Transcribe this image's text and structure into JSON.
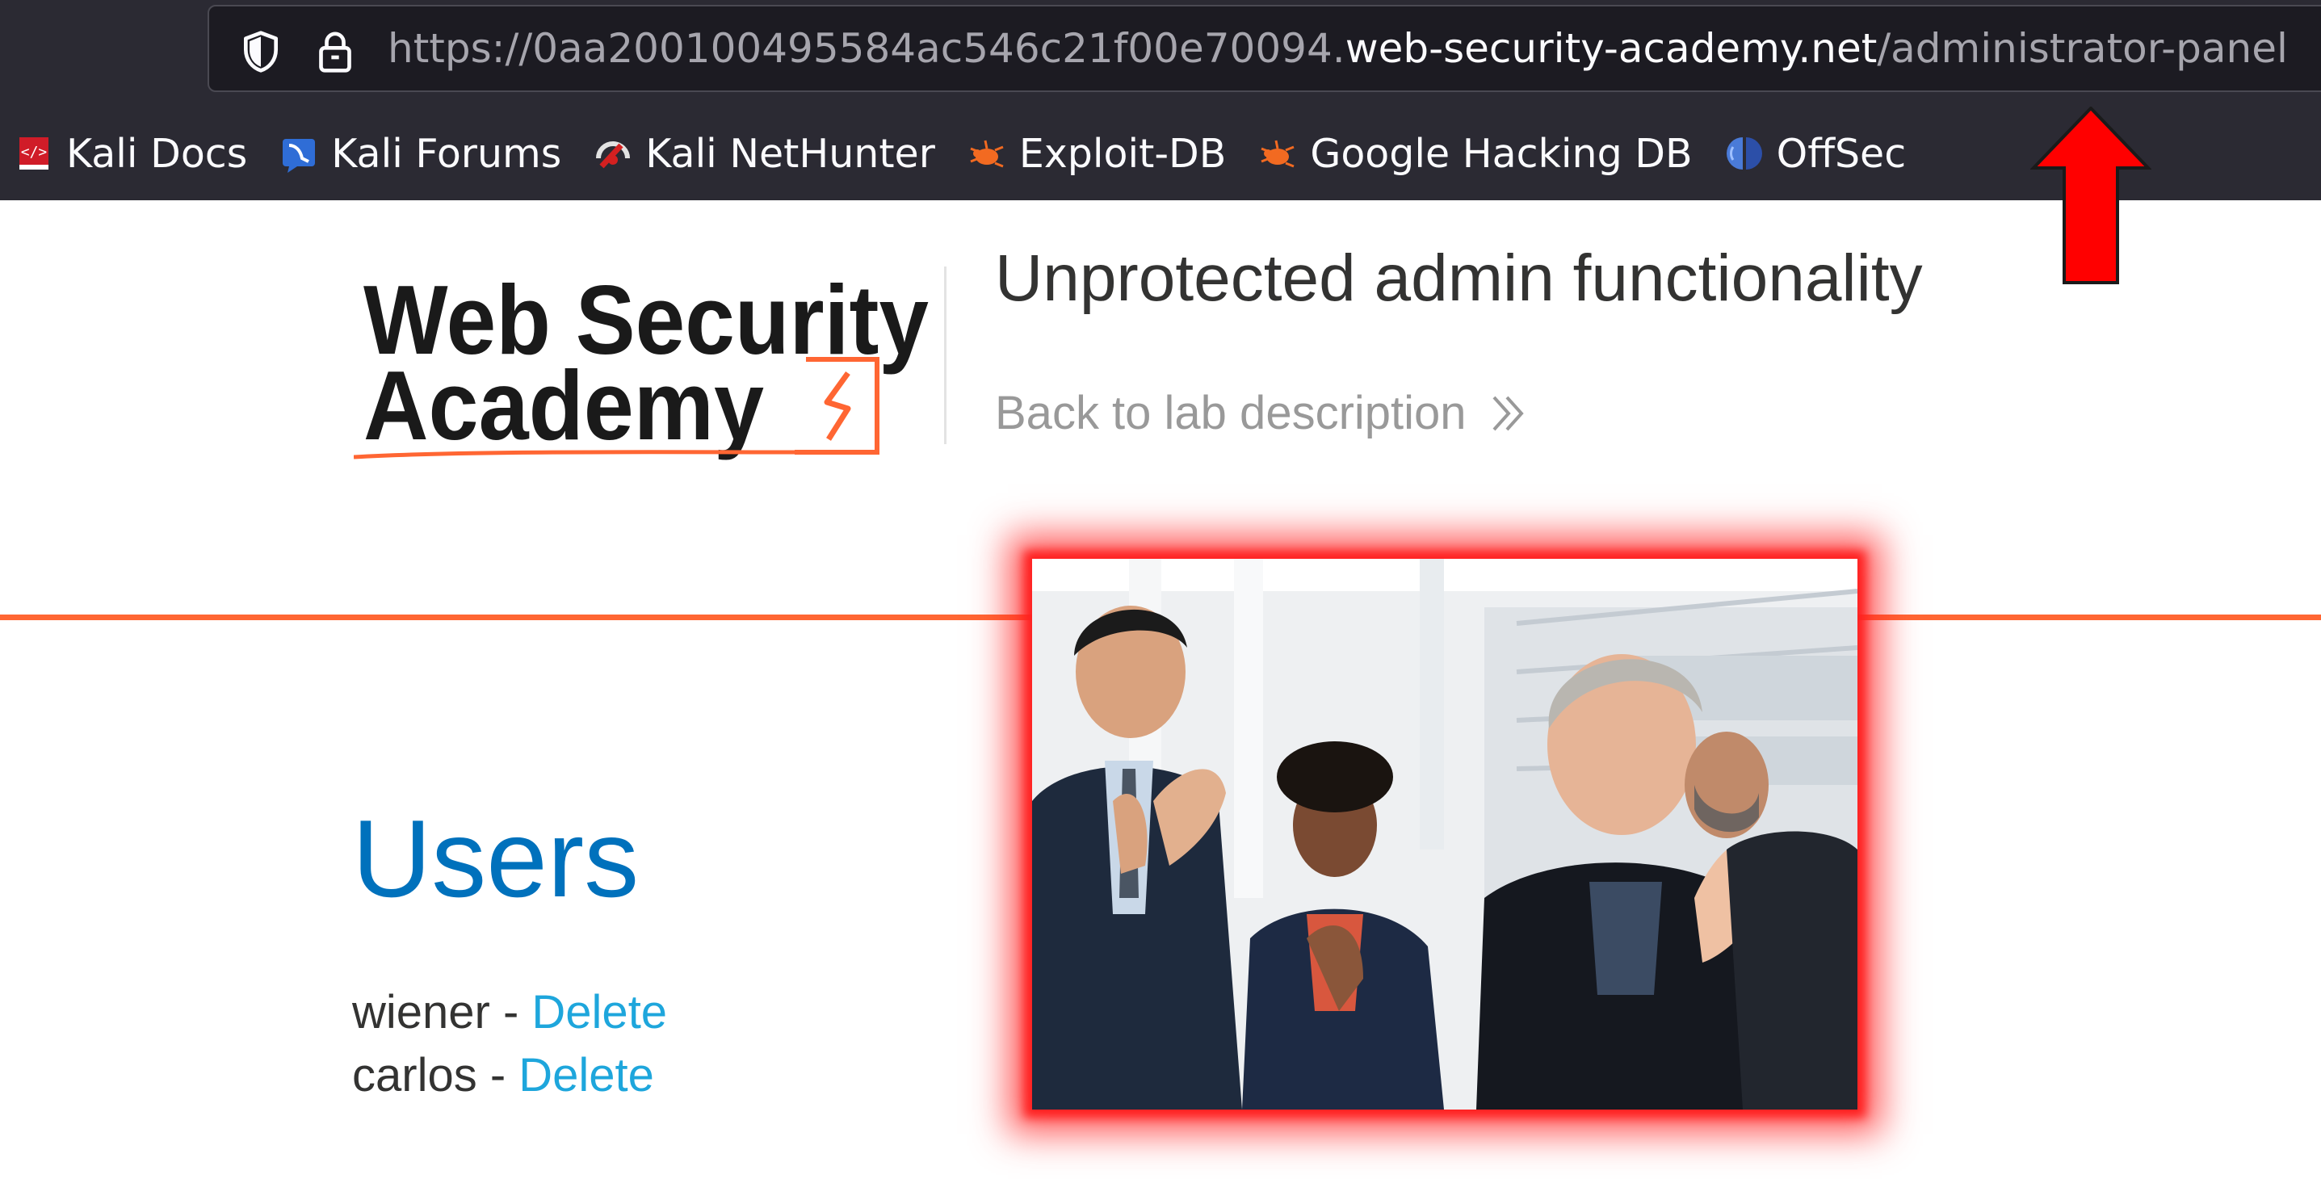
{
  "browser": {
    "url": {
      "scheme": "https://",
      "subdomain": "0aa200100495584ac546c21f00e70094.",
      "domain": "web-security-academy.net",
      "path": "/administrator-panel"
    },
    "bookmarks": [
      {
        "label": "Kali Docs",
        "icon": "kali-docs-icon"
      },
      {
        "label": "Kali Forums",
        "icon": "kali-forums-icon"
      },
      {
        "label": "Kali NetHunter",
        "icon": "kali-nethunter-icon"
      },
      {
        "label": "Exploit-DB",
        "icon": "exploit-db-icon"
      },
      {
        "label": "Google Hacking DB",
        "icon": "google-hacking-db-icon"
      },
      {
        "label": "OffSec",
        "icon": "offsec-icon"
      }
    ]
  },
  "header": {
    "logo": {
      "line1": "Web Security",
      "line2": "Academy"
    },
    "lab_title": "Unprotected admin functionality",
    "back_link": "Back to lab description"
  },
  "main": {
    "heading": "Users",
    "users": [
      {
        "name": "wiener",
        "separator": " - ",
        "action": "Delete"
      },
      {
        "name": "carlos",
        "separator": " - ",
        "action": "Delete"
      }
    ]
  },
  "colors": {
    "accent_orange": "#ff6633",
    "heading_blue": "#0071bc",
    "link_blue": "#1ea6dc",
    "highlight_red": "#ff2020"
  }
}
